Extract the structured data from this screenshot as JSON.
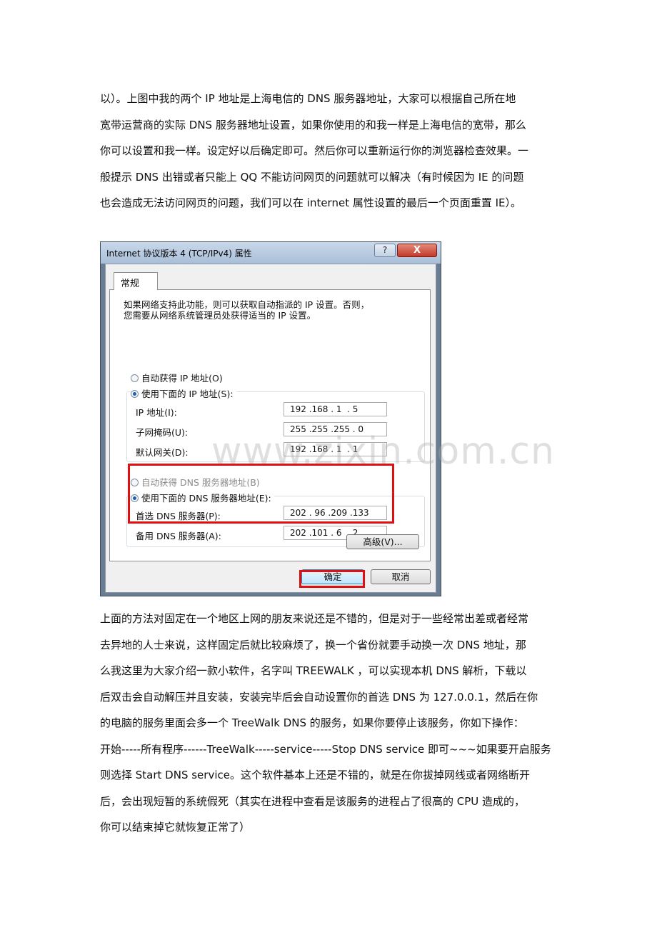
{
  "paragraph1": [
    "以）。上图中我的两个 IP 地址是上海电信的 DNS 服务器地址，大家可以根据自己所在地",
    "宽带运营商的实际 DNS 服务器地址设置，如果你使用的和我一样是上海电信的宽带，那么",
    "你可以设置和我一样。设定好以后确定即可。然后你可以重新运行你的浏览器检查效果。一",
    "般提示 DNS 出错或者只能上 QQ 不能访问网页的问题就可以解决（有时候因为 IE 的问题",
    "也会造成无法访问网页的问题，我们可以在 internet 属性设置的最后一个页面重置 IE）。"
  ],
  "dialog": {
    "title": "Internet 协议版本 4 (TCP/IPv4) 属性",
    "help_label": "?",
    "close_label": "X",
    "tab_general": "常规",
    "description": [
      "如果网络支持此功能，则可以获取自动指派的 IP 设置。否则，",
      "您需要从网络系统管理员处获得适当的 IP 设置。"
    ],
    "radio_auto_ip": "自动获得 IP 地址(O)",
    "radio_manual_ip": "使用下面的 IP 地址(S):",
    "label_ip": "IP 地址(I):",
    "value_ip": "192 .168 . 1  . 5",
    "label_subnet": "子网掩码(U):",
    "value_subnet": "255 .255 .255 . 0",
    "label_gateway": "默认网关(D):",
    "value_gateway": "192 .168 . 1  . 1",
    "radio_auto_dns": "自动获得 DNS 服务器地址(B)",
    "radio_manual_dns": "使用下面的 DNS 服务器地址(E):",
    "label_dns_preferred": "首选 DNS 服务器(P):",
    "value_dns_preferred": "202 . 96 .209 .133",
    "label_dns_alternate": "备用 DNS 服务器(A):",
    "value_dns_alternate": "202 .101 . 6  . 2",
    "button_advanced": "高级(V)...",
    "button_ok": "确定",
    "button_cancel": "取消"
  },
  "watermark": "www.zixin.com.cn",
  "paragraph2": [
    "上面的方法对固定在一个地区上网的朋友来说还是不错的，但是对于一些经常出差或者经常",
    "去异地的人士来说，这样固定后就比较麻烦了，换一个省份就要手动换一次 DNS 地址，那",
    "么我这里为大家介绍一款小软件，名字叫 TREEWALK ，可以实现本机 DNS 解析，下载以",
    "后双击会自动解压并且安装，安装完毕后会自动设置你的首选 DNS 为 127.0.0.1，然后在你",
    "的电脑的服务里面会多一个 TreeWalk  DNS 的服务，如果你要停止该服务，你如下操作：",
    "开始-----所有程序------TreeWalk-----service-----Stop  DNS  service  即可~~~如果要开启服务",
    "则选择 Start  DNS  service。这个软件基本上还是不错的，就是在你拔掉网线或者网络断开",
    "后，会出现短暂的系统假死（其实在进程中查看是该服务的进程占了很高的 CPU 造成的，",
    "你可以结束掉它就恢复正常了）"
  ]
}
